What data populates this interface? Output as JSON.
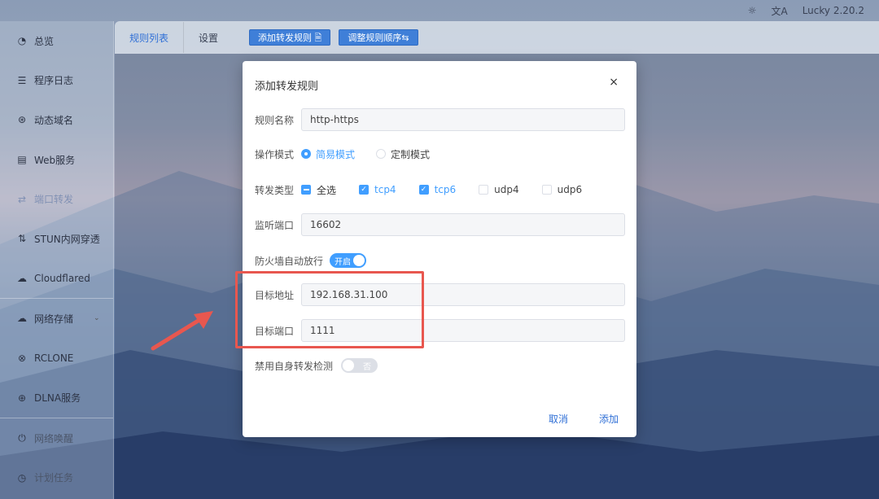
{
  "topbar": {
    "settings_icon": "sun-icon",
    "translate_icon": "translate-icon",
    "version": "Lucky 2.20.2"
  },
  "sidebar": {
    "items": [
      {
        "label": "总览",
        "icon": "dashboard-icon"
      },
      {
        "label": "程序日志",
        "icon": "log-icon"
      },
      {
        "label": "动态域名",
        "icon": "ddns-icon"
      },
      {
        "label": "Web服务",
        "icon": "web-icon"
      },
      {
        "label": "端口转发",
        "icon": "port-forward-icon"
      },
      {
        "label": "STUN内网穿透",
        "icon": "stun-icon"
      },
      {
        "label": "Cloudflared",
        "icon": "cloud-icon"
      },
      {
        "label": "网络存储",
        "icon": "storage-icon"
      },
      {
        "label": "RCLONE",
        "icon": "rclone-icon"
      },
      {
        "label": "DLNA服务",
        "icon": "dlna-icon"
      },
      {
        "label": "网络唤醒",
        "icon": "wake-icon"
      },
      {
        "label": "计划任务",
        "icon": "clock-icon"
      }
    ]
  },
  "tabbar": {
    "tab_rules": "规则列表",
    "tab_settings": "设置",
    "btn_add": "添加转发规则 🗎",
    "btn_reorder": "调整规则顺序⇆"
  },
  "dialog": {
    "title": "添加转发规则",
    "close": "×",
    "rule_name_label": "规则名称",
    "rule_name_value": "http-https",
    "mode_label": "操作模式",
    "mode_simple": "简易模式",
    "mode_custom": "定制模式",
    "type_label": "转发类型",
    "type_all": "全选",
    "type_tcp4": "tcp4",
    "type_tcp6": "tcp6",
    "type_udp4": "udp4",
    "type_udp6": "udp6",
    "listen_port_label": "监听端口",
    "listen_port_value": "16602",
    "firewall_label": "防火墙自动放行",
    "firewall_switch": "开启",
    "target_addr_label": "目标地址",
    "target_addr_value": "192.168.31.100",
    "target_port_label": "目标端口",
    "target_port_value": "1111",
    "disable_check_label": "禁用自身转发检测",
    "disable_check_switch": "否",
    "cancel": "取消",
    "add": "添加"
  },
  "colors": {
    "accent": "#409eff",
    "button": "#3f7fd8",
    "highlight": "#e8574f"
  }
}
